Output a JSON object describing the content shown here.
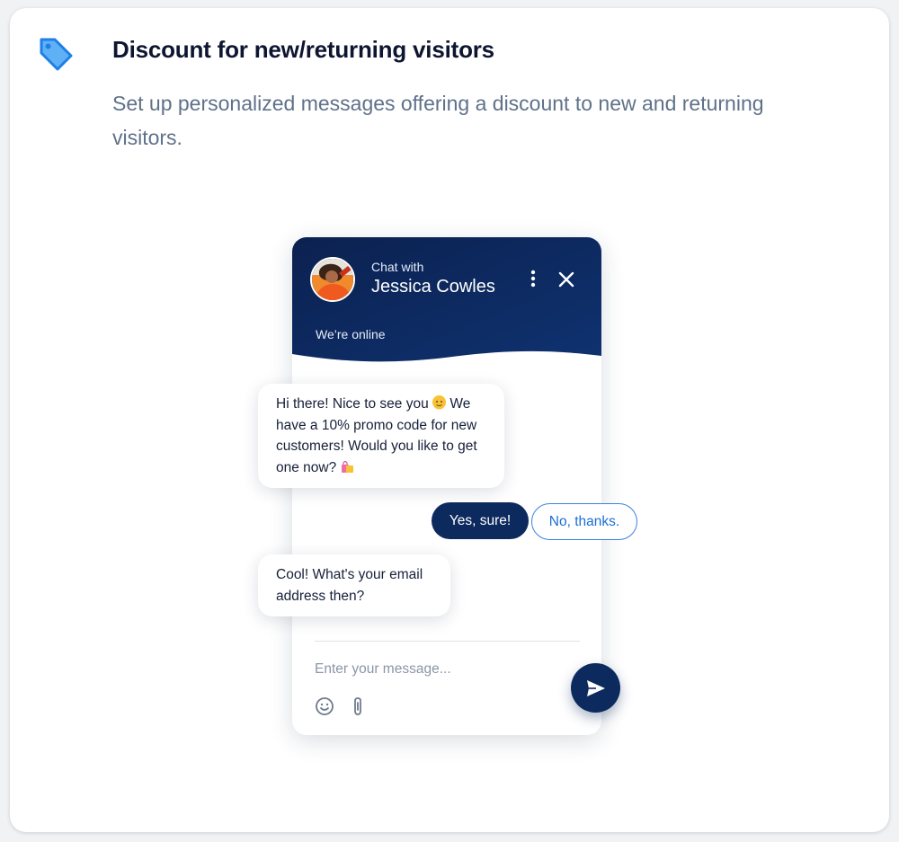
{
  "card": {
    "title": "Discount for new/returning visitors",
    "description": "Set up personalized messages offering a discount to new and returning visitors.",
    "icon": "price-tag-icon"
  },
  "chat_widget": {
    "chat_with_label": "Chat with",
    "agent_name": "Jessica Cowles",
    "status": "We’re online",
    "messages": [
      {
        "from": "agent",
        "text_before_emoji": "Hi there! Nice to see you",
        "text_after_emoji": "We have a 10% promo code for new customers! Would you like to get one now?",
        "emojis": [
          "slightly-smiling-face",
          "shopping-bags"
        ]
      },
      {
        "from": "agent",
        "text": "Cool! What's your email address then?"
      }
    ],
    "quick_replies": {
      "yes": "Yes, sure!",
      "no": "No, thanks."
    },
    "input_placeholder": "Enter your message...",
    "icons": [
      "more-vertical-icon",
      "close-icon",
      "emoji-icon",
      "paperclip-icon",
      "send-icon"
    ]
  },
  "colors": {
    "accent_blue": "#1e7fe8",
    "header_navy": "#0d2a5e",
    "title_text": "#0d1530",
    "description_text": "#5f7189"
  }
}
